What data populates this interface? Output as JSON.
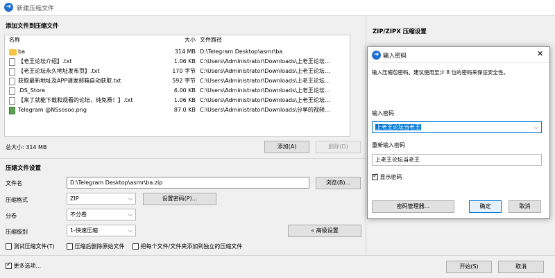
{
  "window": {
    "title": "新建压缩文件"
  },
  "files_section": {
    "header": "添加文件到压缩文件",
    "columns": {
      "name": "名称",
      "size": "大小",
      "path": "文件路径"
    },
    "rows": [
      {
        "icon": "folder-icon",
        "name": "ba",
        "size": "314 MB",
        "path": "D:\\Telegram Desktop\\asmr\\ba"
      },
      {
        "icon": "text-file-icon",
        "name": "【老王论坛介绍】.txt",
        "size": "1.06 KB",
        "path": "C:\\Users\\Administrator\\Downloads\\上老王论坛..."
      },
      {
        "icon": "text-file-icon",
        "name": "【老王论坛永久地址发布页】.txt",
        "size": "170 字节",
        "path": "C:\\Users\\Administrator\\Downloads\\上老王论坛..."
      },
      {
        "icon": "text-file-icon",
        "name": "获取最新地址及APP请发邮箱自动获取.txt",
        "size": "592 字节",
        "path": "C:\\Users\\Administrator\\Downloads\\上老王论坛..."
      },
      {
        "icon": "file-icon",
        "name": ".DS_Store",
        "size": "6.00 KB",
        "path": "C:\\Users\\Administrator\\Downloads\\上老王论坛..."
      },
      {
        "icon": "text-file-icon",
        "name": "【来了就能下载和观看的论坛，纯免费！】.txt",
        "size": "1.06 KB",
        "path": "C:\\Users\\Administrator\\Downloads\\上老王论坛..."
      },
      {
        "icon": "image-file-icon",
        "name": "Telegram @NSsosoo.png",
        "size": "87.0 KB",
        "path": "C:\\Users\\Administrator\\Downloads\\分享的视频..."
      }
    ],
    "total_size": "总大小: 314 MB",
    "add_button": "添加(A)",
    "delete_button": "删除(D)"
  },
  "settings": {
    "header": "压缩文件设置",
    "filename_label": "文件名",
    "filename_value": "D:\\Telegram Desktop\\asmr\\ba.zip",
    "browse_button": "浏览(B)...",
    "format_label": "压缩格式",
    "format_value": "ZIP",
    "set_password_button": "设置密码(P)...",
    "split_label": "分卷",
    "split_value": "不分卷",
    "level_label": "压缩级别",
    "level_value": "1-快速压缩",
    "advanced_button": "« 高级设置",
    "checkbox_test": "测试压缩文件(T)",
    "checkbox_delete": "压缩后删除原始文件",
    "checkbox_separate": "把每个文件/文件夹添加到独立的压缩文件"
  },
  "bottom": {
    "more_options": "更多选项...",
    "start_button": "开始(S)",
    "cancel_button": "取消"
  },
  "zip_panel": {
    "header": "ZIP/ZIPX 压缩设置"
  },
  "password_dialog": {
    "title": "输入密码",
    "description": "输入压缩包密码。建议使用至少 8 位的密码来保证安全性。",
    "password_label": "输入密码",
    "password_value": "上老王论坛当老王",
    "reenter_label": "重新输入密码",
    "reenter_value": "上老王论坛当老王",
    "show_password": "显示密码",
    "manager_button": "密码管理器...",
    "ok_button": "确定",
    "cancel_button": "取消",
    "accent_color": "#0078d7"
  }
}
